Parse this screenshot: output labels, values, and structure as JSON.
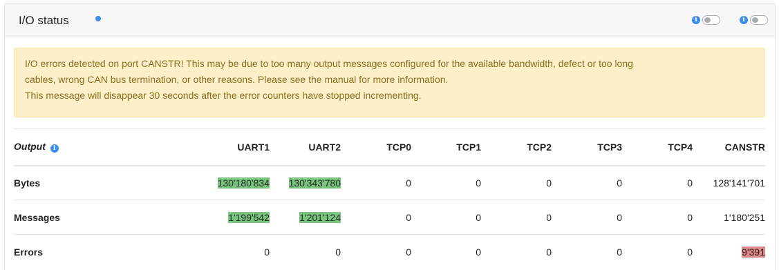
{
  "header": {
    "title": "I/O status",
    "status_dot_color": "#3d8ef0",
    "toggles": [
      {
        "icon": "info-icon",
        "state": "off"
      },
      {
        "icon": "info-icon",
        "state": "off"
      }
    ]
  },
  "alert": {
    "line1": "I/O errors detected on port CANSTR! This may be due to too many output messages configured for the available bandwidth, defect or too long",
    "line2": "cables, wrong CAN bus termination, or other reasons. Please see the manual for more information.",
    "line3": "This message will disappear 30 seconds after the error counters have stopped incrementing."
  },
  "table": {
    "corner_label": "Output",
    "corner_icon": "info-icon",
    "columns": [
      "UART1",
      "UART2",
      "TCP0",
      "TCP1",
      "TCP2",
      "TCP3",
      "TCP4",
      "CANSTR"
    ],
    "rows": [
      {
        "label": "Bytes",
        "values": [
          "130'180'834",
          "130'343'780",
          "0",
          "0",
          "0",
          "0",
          "0",
          "128'141'701"
        ]
      },
      {
        "label": "Messages",
        "values": [
          "1'199'542",
          "1'201'124",
          "0",
          "0",
          "0",
          "0",
          "0",
          "1'180'251"
        ]
      },
      {
        "label": "Errors",
        "values": [
          "0",
          "0",
          "0",
          "0",
          "0",
          "0",
          "0",
          "9'391"
        ]
      }
    ],
    "highlight_colors": {
      "ok": "#7bc47f",
      "error": "#d88a8a"
    }
  }
}
